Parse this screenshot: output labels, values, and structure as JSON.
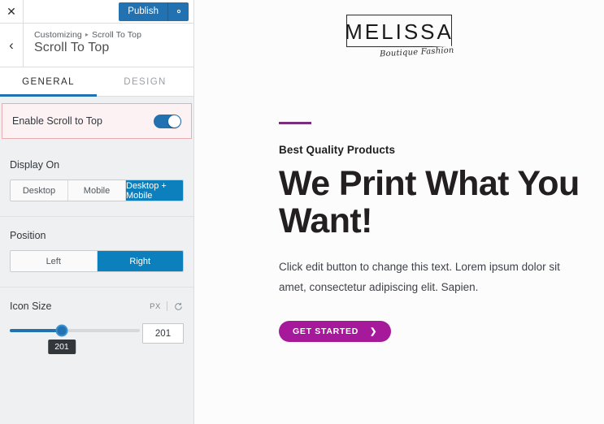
{
  "panel": {
    "topbar": {
      "close_icon": "close-icon",
      "publish_label": "Publish",
      "gear_icon": "gear-icon"
    },
    "header": {
      "back_icon": "chevron-left-icon",
      "breadcrumb_root": "Customizing",
      "breadcrumb_sep": "▸",
      "breadcrumb_current": "Scroll To Top",
      "title": "Scroll To Top"
    },
    "tabs": [
      {
        "label": "GENERAL",
        "active": true
      },
      {
        "label": "DESIGN",
        "active": false
      }
    ],
    "enable_row": {
      "label": "Enable Scroll to Top",
      "toggle_state": "on",
      "highlight_color": "#e8adb0",
      "highlight_bg": "#fdf2f3"
    },
    "display_on": {
      "label": "Display On",
      "options": [
        "Desktop",
        "Mobile",
        "Desktop + Mobile"
      ],
      "selected": "Desktop + Mobile"
    },
    "position": {
      "label": "Position",
      "options": [
        "Left",
        "Right"
      ],
      "selected": "Right"
    },
    "icon_size": {
      "label": "Icon Size",
      "unit": "PX",
      "reset_icon": "reset-icon",
      "value": "201",
      "tooltip": "201",
      "slider_percent": 40
    },
    "accent_blue": "#2271b1"
  },
  "preview": {
    "logo": {
      "name": "MELISSA",
      "tagline": "Boutique Fashion"
    },
    "hero": {
      "accent_color": "#7b2d7e",
      "eyebrow": "Best Quality Products",
      "title": "We Print What You Want!",
      "paragraph": "Click edit button to change this text. Lorem ipsum dolor sit amet, consectetur adipiscing elit. Sapien.",
      "cta_label": "GET STARTED",
      "cta_chevron": "❯",
      "cta_color": "#a6199a"
    }
  }
}
